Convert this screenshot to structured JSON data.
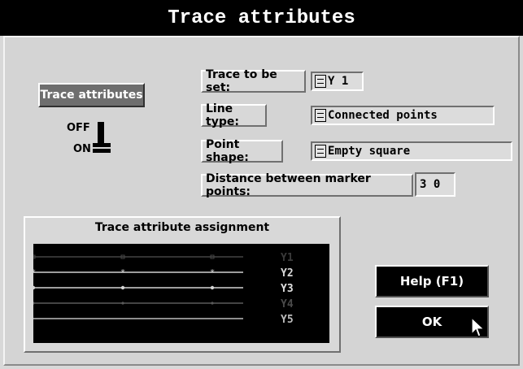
{
  "window": {
    "title": "Trace attributes"
  },
  "toggle": {
    "button_label": "Trace attributes",
    "off_label": "OFF",
    "on_label": "ON"
  },
  "fields": {
    "trace_to_set": {
      "label": "Trace to be set:",
      "value": "Y 1"
    },
    "line_type": {
      "label": "Line type:",
      "value": "Connected points"
    },
    "point_shape": {
      "label": "Point shape:",
      "value": "Empty square"
    },
    "marker_distance": {
      "label": "Distance between marker points:",
      "value": "3 0"
    }
  },
  "assignment": {
    "title": "Trace attribute assignment",
    "traces": [
      {
        "name": "Y1",
        "marker": "empty-square",
        "color": "#444444",
        "label_color": "#3a3a3a"
      },
      {
        "name": "Y2",
        "marker": "star",
        "color": "#cfcfcf",
        "label_color": "#d8d8d8"
      },
      {
        "name": "Y3",
        "marker": "dot",
        "color": "#d4d4d4",
        "label_color": "#e0e0e0"
      },
      {
        "name": "Y4",
        "marker": "small-dot",
        "color": "#5a5a5a",
        "label_color": "#4a4a4a"
      },
      {
        "name": "Y5",
        "marker": "none",
        "color": "#bdbdbd",
        "label_color": "#bdbdbd"
      }
    ]
  },
  "buttons": {
    "help": "Help (F1)",
    "ok": "OK"
  }
}
